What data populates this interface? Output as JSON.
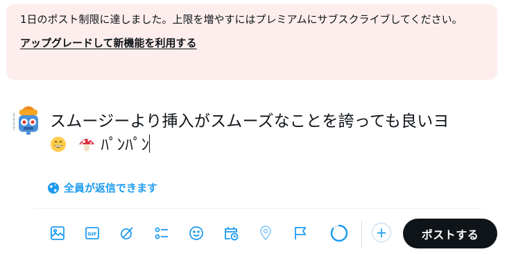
{
  "notice": {
    "message": "1日のポスト制限に達しました。上限を増やすにはプレミアムにサブスクライブしてください。",
    "link_label": "アップグレードして新機能を利用する"
  },
  "compose": {
    "text": "スムージーより挿入がスムーズなことを誇っても良いヨ",
    "emoji_1": "😁",
    "emoji_2": "🍄",
    "text_after": "ﾊﾟﾝﾊﾟﾝ",
    "reply_setting": "全員が返信できます"
  },
  "toolbar": {
    "icons": [
      "image-icon",
      "gif-icon",
      "grok-icon",
      "poll-icon",
      "emoji-icon",
      "schedule-icon",
      "location-icon",
      "flag-icon"
    ],
    "char_progress": 0.85,
    "add_label": "+",
    "post_label": "ポストする"
  },
  "colors": {
    "accent": "#1d9bf0",
    "notice_bg": "#fdeeed",
    "post_button_bg": "#0f1419"
  }
}
